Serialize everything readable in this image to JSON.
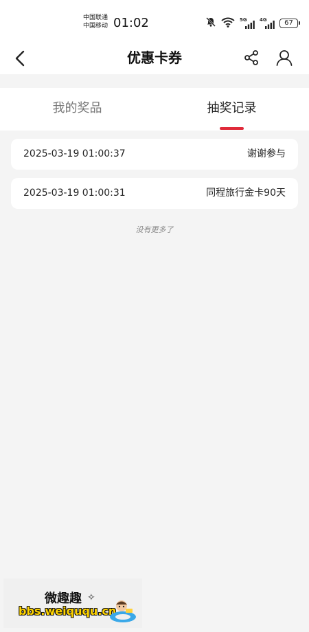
{
  "status_bar": {
    "carrier1": "中国联通",
    "carrier2": "中国移动",
    "time": "01:02",
    "net1": "5G",
    "net2": "4G",
    "battery": "67"
  },
  "header": {
    "title": "优惠卡券"
  },
  "tabs": [
    {
      "label": "我的奖品",
      "active": false
    },
    {
      "label": "抽奖记录",
      "active": true
    }
  ],
  "records": [
    {
      "time": "2025-03-19 01:00:37",
      "prize": "谢谢参与"
    },
    {
      "time": "2025-03-19 01:00:31",
      "prize": "同程旅行金卡90天"
    }
  ],
  "list_end_text": "没有更多了",
  "watermark": {
    "title": "微趣趣",
    "url": "bbs.weiququ.cn"
  },
  "colors": {
    "accent": "#e02a3a",
    "background": "#f4f4f4",
    "card": "#ffffff"
  },
  "icons": [
    "bell-off-icon",
    "wifi-icon",
    "signal-icon",
    "battery-icon",
    "back-arrow-icon",
    "share-icon",
    "user-icon"
  ]
}
